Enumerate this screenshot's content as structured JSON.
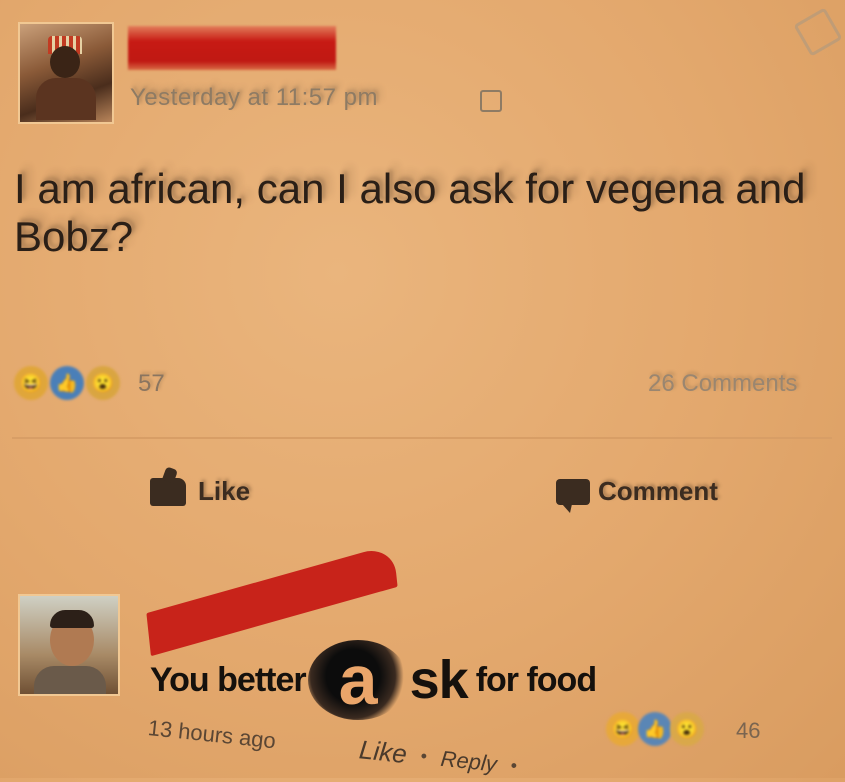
{
  "post": {
    "timestamp": "Yesterday at 11:57 pm",
    "text": "I am african, can I also ask for vegena and Bobz?",
    "reaction_count": "57",
    "comments_count": "26 Comments",
    "like_label": "Like",
    "comment_label": "Comment"
  },
  "reply": {
    "text_before": "You better",
    "text_big_a": "a",
    "text_sk": "sk",
    "text_after": "for food",
    "time": "13 hours ago",
    "like_label": "Like",
    "reply_label": "Reply",
    "reaction_count": "46"
  },
  "icons": [
    "profile-avatar",
    "globe-icon",
    "edit-icon",
    "haha-reaction-icon",
    "like-reaction-icon",
    "wow-reaction-icon",
    "thumbs-up-icon",
    "comment-icon"
  ],
  "colors": {
    "background": "#e3a86d",
    "redaction": "#c71a14",
    "text": "#2a1f17"
  }
}
